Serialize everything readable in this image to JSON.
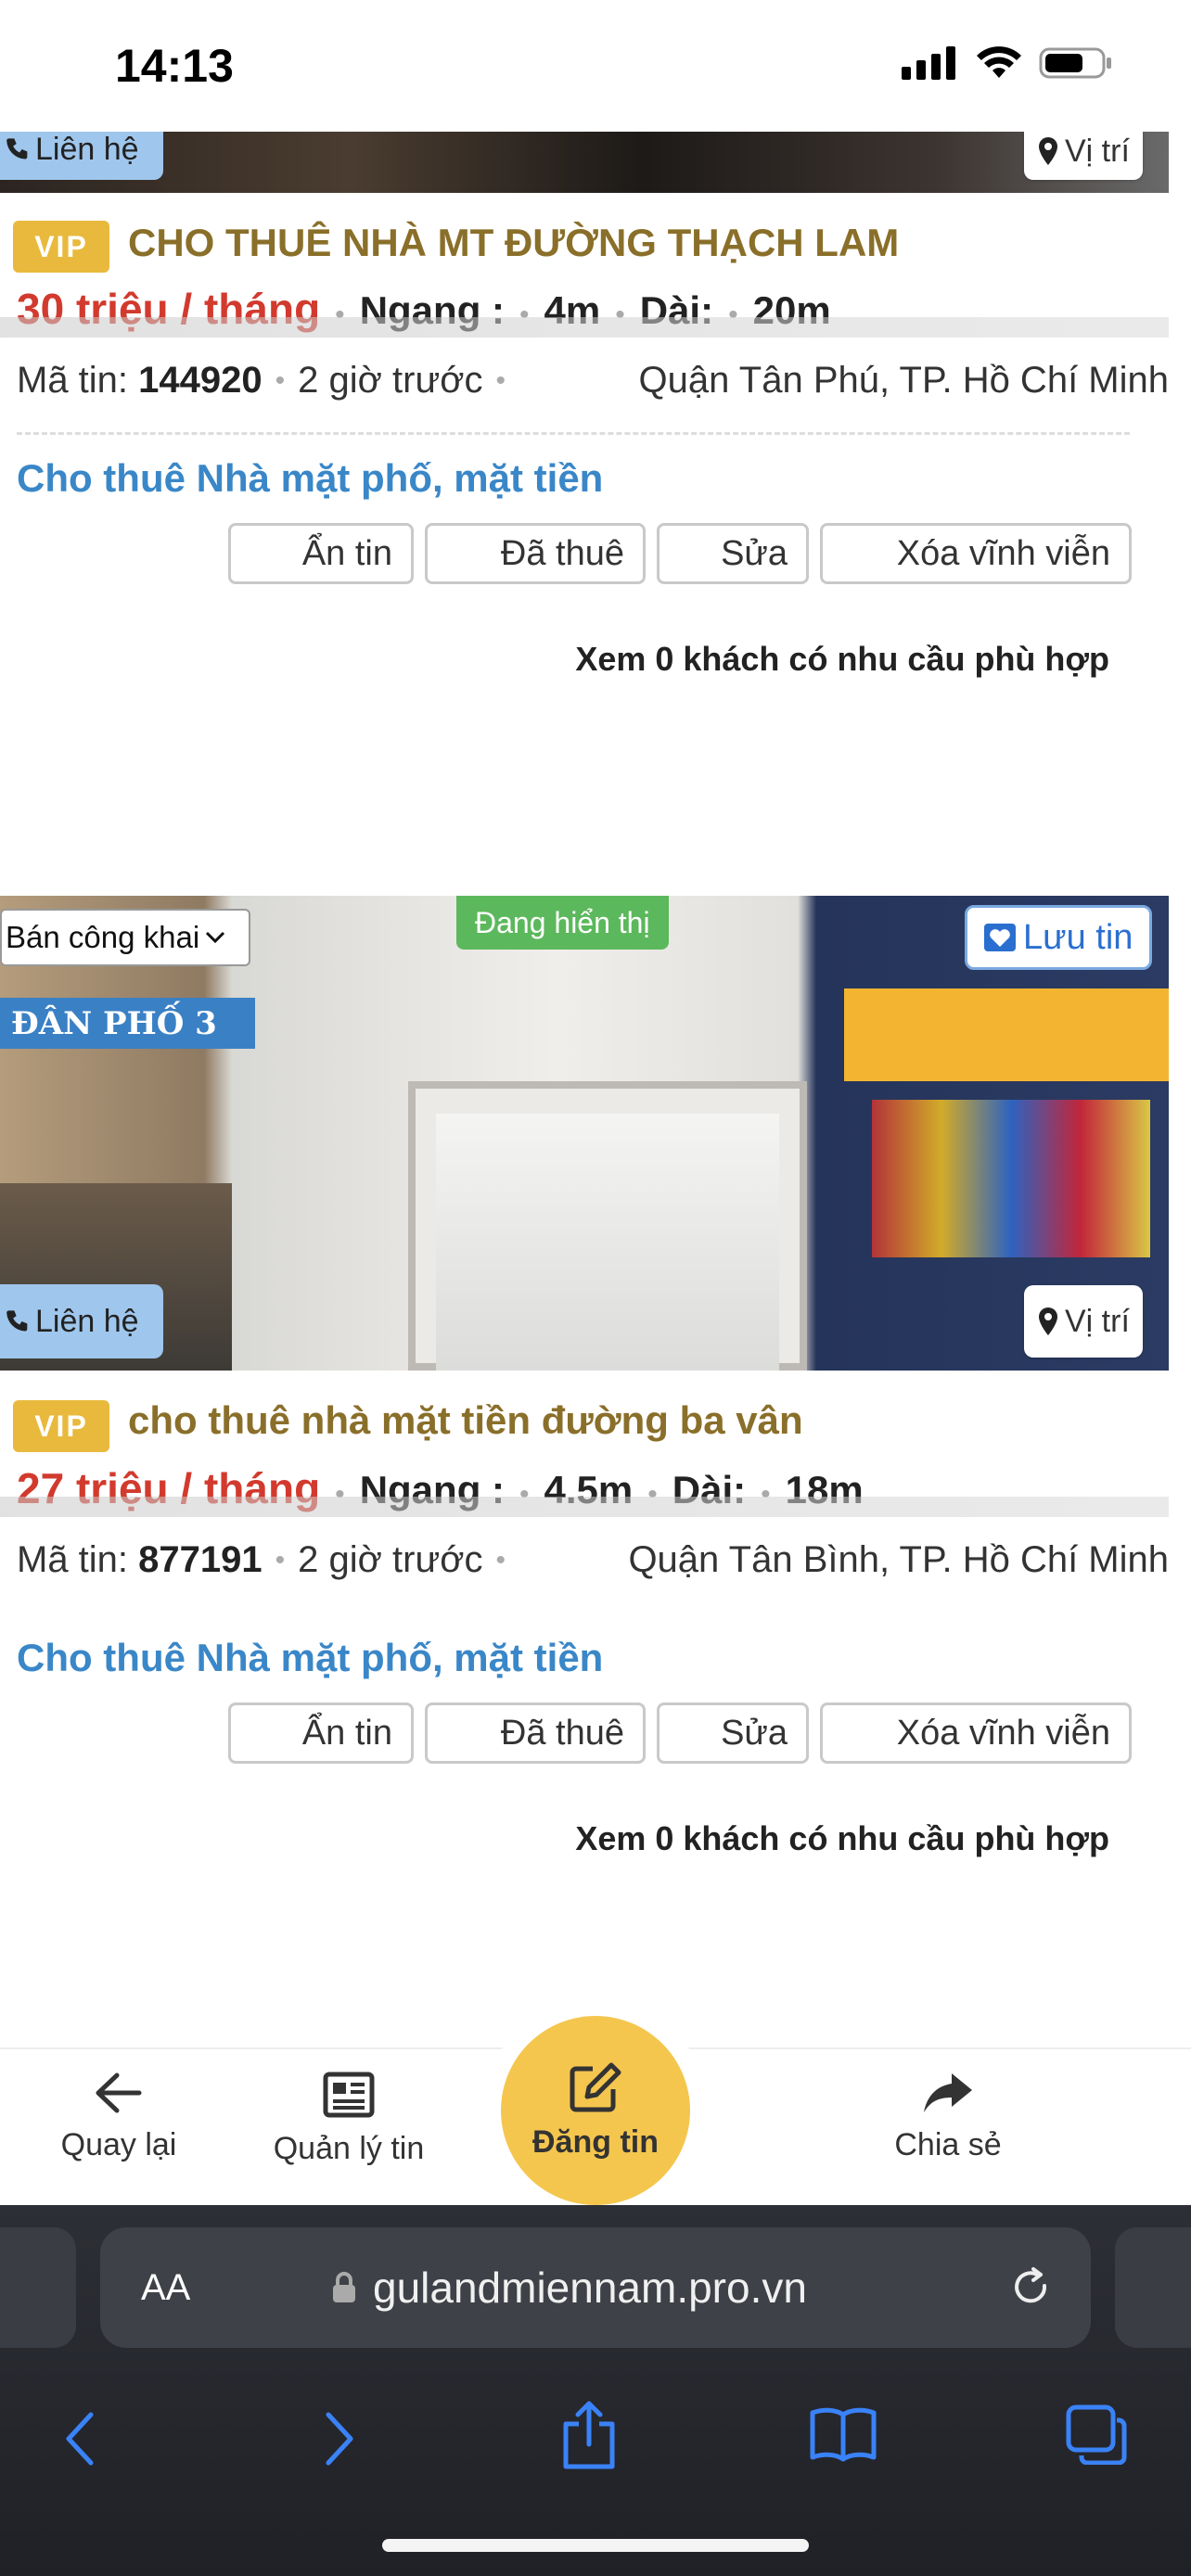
{
  "status_bar": {
    "time": "14:13"
  },
  "listings": [
    {
      "contact_label": "Liên hệ",
      "location_label": "Vị trí",
      "vip": "VIP",
      "title": "CHO THUÊ NHÀ MT ĐƯỜNG THẠCH LAM",
      "price": "30 triệu / tháng",
      "width_label": "Ngang :",
      "width_value": "4m",
      "length_label": "Dài:",
      "length_value": "20m",
      "code_label": "Mã tin:",
      "code": "144920",
      "posted": "2 giờ trước",
      "location": "Quận Tân Phú, TP. Hồ Chí Minh",
      "category": "Cho thuê Nhà mặt phố, mặt tiền",
      "actions": [
        "Ẩn tin",
        "Đã thuê",
        "Sửa",
        "Xóa vĩnh viễn"
      ],
      "matches": "Xem 0 khách có nhu cầu phù hợp"
    },
    {
      "visibility_select": "Bán công khai",
      "status_chip": "Đang hiển thị",
      "save_label": "Lưu tin",
      "contact_label": "Liên hệ",
      "location_label": "Vị trí",
      "photo_sign": "ĐÂN PHỐ 3",
      "vip": "VIP",
      "title": "cho thuê nhà mặt tiền đường ba vân",
      "price": "27 triệu / tháng",
      "width_label": "Ngang :",
      "width_value": "4.5m",
      "length_label": "Dài:",
      "length_value": "18m",
      "code_label": "Mã tin:",
      "code": "877191",
      "posted": "2 giờ trước",
      "location": "Quận Tân Bình, TP. Hồ Chí Minh",
      "category": "Cho thuê Nhà mặt phố, mặt tiền",
      "actions": [
        "Ẩn tin",
        "Đã thuê",
        "Sửa",
        "Xóa vĩnh viễn"
      ],
      "matches": "Xem 0 khách có nhu cầu phù hợp"
    }
  ],
  "bottom_nav": {
    "back": "Quay lại",
    "manage": "Quản lý tin",
    "post": "Đăng tin",
    "share": "Chia sẻ"
  },
  "safari": {
    "aa": "AA",
    "url": "gulandmiennam.pro.vn"
  },
  "colors": {
    "price_red": "#d23a2e",
    "title_gold": "#8a6f2a",
    "vip_badge": "#e8b93c",
    "link_blue": "#3a87c8",
    "post_button": "#f5c64e",
    "status_green": "#5cb85c"
  }
}
